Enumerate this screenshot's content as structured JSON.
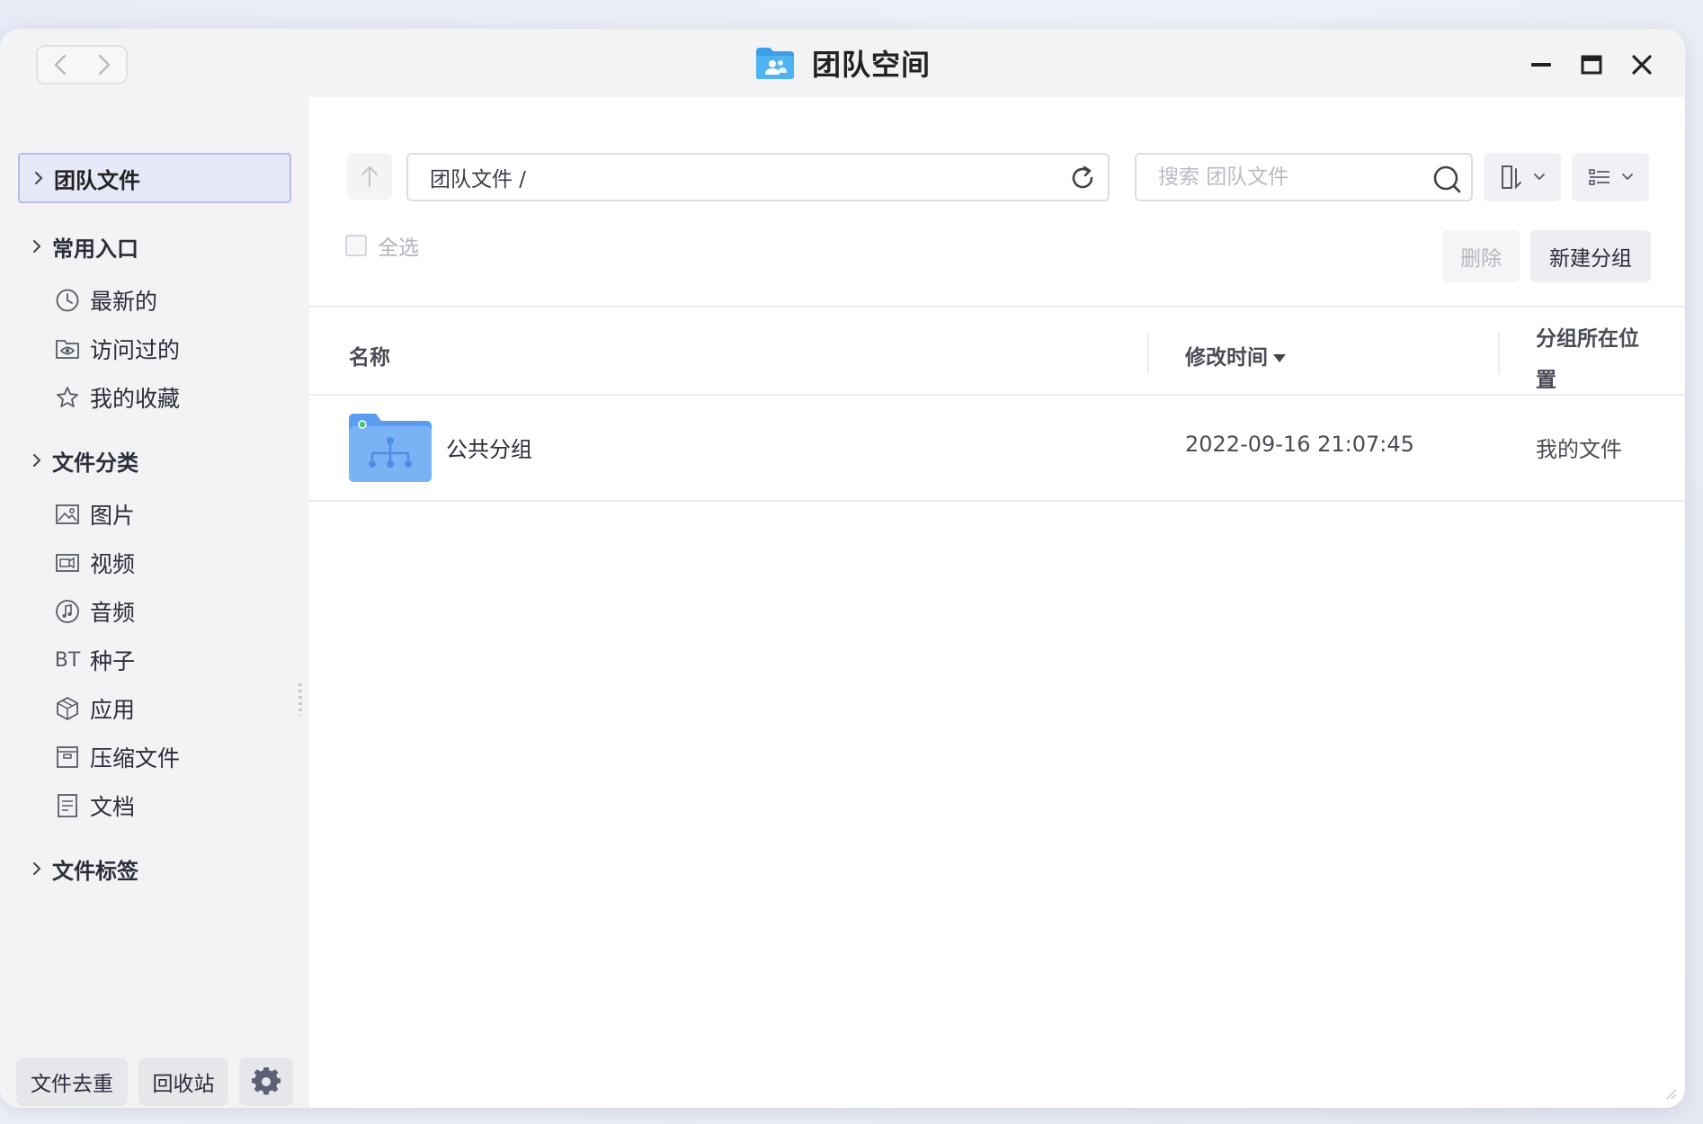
{
  "window": {
    "title": "团队空间"
  },
  "sidebar": {
    "selected": "团队文件",
    "sections": [
      {
        "label": "常用入口"
      },
      {
        "label": "文件分类"
      },
      {
        "label": "文件标签"
      }
    ],
    "quick_access": [
      {
        "label": "最新的",
        "icon": "clock-icon"
      },
      {
        "label": "访问过的",
        "icon": "eye-folder-icon"
      },
      {
        "label": "我的收藏",
        "icon": "star-icon"
      }
    ],
    "categories": [
      {
        "label": "图片",
        "icon": "image-icon"
      },
      {
        "label": "视频",
        "icon": "video-icon"
      },
      {
        "label": "音频",
        "icon": "music-icon"
      },
      {
        "label": "种子",
        "icon": "bt-icon",
        "icon_text": "BT"
      },
      {
        "label": "应用",
        "icon": "package-icon"
      },
      {
        "label": "压缩文件",
        "icon": "archive-icon"
      },
      {
        "label": "文档",
        "icon": "document-icon"
      }
    ],
    "footer": {
      "dedupe": "文件去重",
      "recycle": "回收站"
    }
  },
  "toolbar": {
    "path": "团队文件 /",
    "search_placeholder": "搜索 团队文件",
    "select_all": "全选",
    "delete": "删除",
    "new_group": "新建分组"
  },
  "table": {
    "headers": {
      "name": "名称",
      "mtime": "修改时间",
      "location_line1": "分组所在位",
      "location_line2": "置"
    },
    "rows": [
      {
        "name": "公共分组",
        "mtime": "2022-09-16 21:07:45",
        "location": "我的文件"
      }
    ]
  },
  "colors": {
    "accent": "#5b8def",
    "folder": "#74aaf7",
    "selected_bg": "#e6e9f8"
  }
}
